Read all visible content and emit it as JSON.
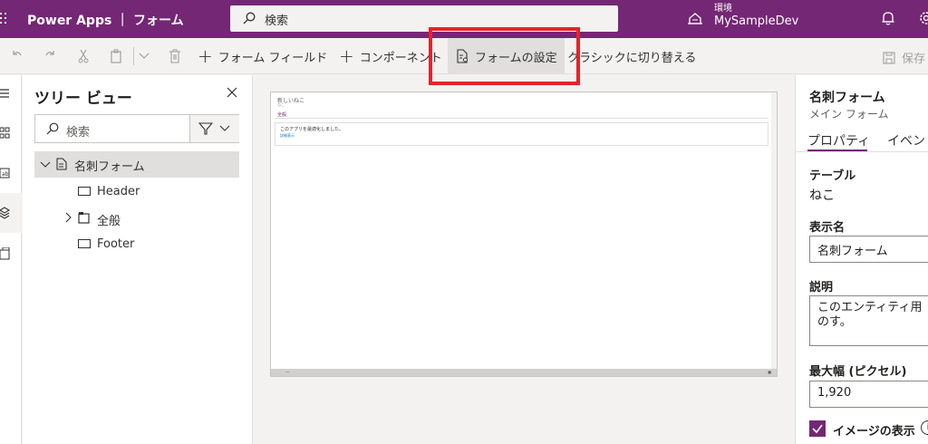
{
  "header": {
    "app_title": "Power Apps ｜ フォーム",
    "search_placeholder": "検索",
    "env_label": "環境",
    "env_name": "MySampleDev",
    "icons": [
      "waffle-icon",
      "search-icon",
      "environment-icon",
      "bell-icon",
      "gear-icon"
    ]
  },
  "commandbar": {
    "add_form_field": "フォーム フィールド",
    "add_component": "コンポーネント",
    "form_settings": "フォームの設定",
    "switch_classic": "クラシックに切り替える",
    "save": "保存"
  },
  "highlight_color": "#e3242b",
  "accent_color": "#742774",
  "tree": {
    "title": "ツリー ビュー",
    "search_placeholder": "検索",
    "root": "名刺フォーム",
    "items": [
      {
        "label": "Header",
        "icon": "header-icon"
      },
      {
        "label": "全般",
        "icon": "tab-icon"
      },
      {
        "label": "Footer",
        "icon": "footer-icon"
      }
    ]
  },
  "canvas": {
    "record_title": "新しいねこ",
    "record_subtitle": "ねこ",
    "tab_label": "全般",
    "section_text": "このアプリを最適化しました。",
    "section_link": "詳細表示"
  },
  "properties": {
    "form_name": "名刺フォーム",
    "form_type": "メイン フォーム",
    "tab_properties": "プロパティ",
    "tab_events": "イベント",
    "table_label": "テーブル",
    "table_value": "ねこ",
    "display_name_label": "表示名",
    "display_name_value": "名刺フォーム",
    "description_label": "説明",
    "description_value": "このエンティティ用のす。",
    "max_width_label": "最大幅 (ピクセル)",
    "max_width_value": "1,920",
    "show_image_label": "イメージの表示",
    "show_image_checked": true
  }
}
